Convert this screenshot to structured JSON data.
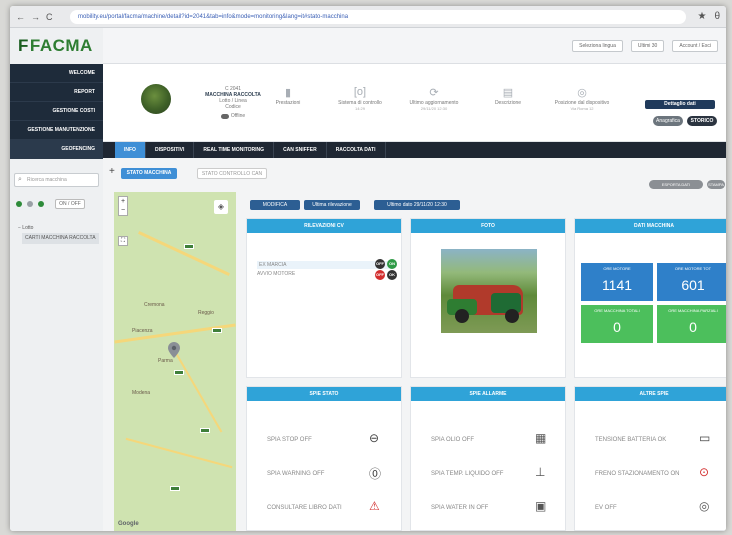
{
  "browser": {
    "nav": [
      "←",
      "→",
      "C"
    ],
    "url": "mobility.eu/portal/facma/machine/detail?id=2041&tab=info&mode=monitoring&lang=it#stato-macchina",
    "ext": [
      "★",
      "θ"
    ]
  },
  "sidebar": {
    "logo_prefix": "F",
    "logo_text": "FACMA",
    "items": [
      {
        "label": "WELCOME"
      },
      {
        "label": "REPORT"
      },
      {
        "label": "GESTIONE COSTI"
      },
      {
        "label": "GESTIONE MANUTENZIONE"
      },
      {
        "label": "GEOFENCING"
      }
    ],
    "search_placeholder": "Ricerca macchina",
    "filter_toggle": "ON / OFF",
    "tree_root": "− Lotto",
    "tree_leaf": "CARTI MACCHINA RACCOLTA"
  },
  "topbar": {
    "sel1": "Seleziona lingua",
    "sel2": "Ultimi 30",
    "user": "Account / Esci"
  },
  "machine": {
    "code": "C 2041",
    "name": "MACCHINA RACCOLTA",
    "line2": "Lotto / Linea",
    "line3": "Codice",
    "status": "Offline",
    "stats": [
      {
        "icon": "bar-chart-icon",
        "glyph": "▮",
        "label": "Prestazioni",
        "sub": ""
      },
      {
        "icon": "log-icon",
        "glyph": "[o]",
        "label": "Sistema di controllo",
        "sub": "14:29"
      },
      {
        "icon": "refresh-icon",
        "glyph": "⟳",
        "label": "Ultimo aggiornamento",
        "sub": "29/11/20 12:30"
      },
      {
        "icon": "document-icon",
        "glyph": "▤",
        "label": "Descrizione",
        "sub": ""
      },
      {
        "icon": "location-icon",
        "glyph": "◎",
        "label": "Posizione dal dispositivo",
        "sub": "Via Roma 12"
      }
    ],
    "btn_top": "Dettaglio dati",
    "btn_gray": "Anagrafica",
    "btn_dark": "STORICO"
  },
  "tabs": [
    "INFO",
    "DISPOSITIVI",
    "REAL TIME MONITORING",
    "CAN SNIFFER",
    "RACCOLTA DATI"
  ],
  "subtabs": {
    "plus": "+",
    "active": "STATO MACCHINA",
    "inactive": "STATO CONTROLLO CAN",
    "pill1": "ESPORTA DATI",
    "pill2": "STAMPA"
  },
  "map": {
    "zoom_in": "+",
    "zoom_out": "−",
    "fullscreen": "⛶",
    "layers": "◈",
    "google": "Google",
    "towns": [
      "Piacenza",
      "Parma",
      "Reggio",
      "Modena",
      "Cremona"
    ]
  },
  "infostrip": {
    "modifica": "MODIFICA",
    "mid": "Ultima rilevazione",
    "last": "Ultimo dato 29/11/20 12:30"
  },
  "panels": {
    "rilevazioni": {
      "title": "RILEVAZIONI CV",
      "rows": [
        {
          "label": "EX MARCIA",
          "badge1": "OFF",
          "badge1_color": "#333333",
          "badge2": "ON",
          "badge2_color": "#2e9a45"
        },
        {
          "label": "AVVIO MOTORE",
          "badge1": "OFF",
          "badge1_color": "#d32f2f",
          "badge2": "OK",
          "badge2_color": "#333333"
        }
      ]
    },
    "foto": {
      "title": "FOTO"
    },
    "dati": {
      "title": "DATI MACCHINA",
      "tiles": [
        {
          "label": "ORE MOTORE",
          "value": "1141",
          "color": "#2f80c9"
        },
        {
          "label": "ORE MOTORE TOT",
          "value": "601",
          "color": "#2f80c9"
        },
        {
          "label": "ORE MACCHINA TOTALI",
          "value": "0",
          "color": "#4cbf5c"
        },
        {
          "label": "ORE MACCHINA PARZIALI",
          "value": "0",
          "color": "#4cbf5c"
        }
      ]
    },
    "spie_stato": {
      "title": "SPIE STATO",
      "items": [
        {
          "label": "SPIA STOP OFF",
          "icon": "stop-indicator-icon",
          "glyph": "⊖",
          "color": "#444444"
        },
        {
          "label": "SPIA WARNING OFF",
          "icon": "warning-indicator-icon",
          "glyph": "⓪",
          "color": "#444444"
        },
        {
          "label": "CONSULTARE LIBRO DATI",
          "icon": "warning-triangle-icon",
          "glyph": "⚠",
          "color": "#d32f2f"
        }
      ]
    },
    "spie_allarme": {
      "title": "SPIE ALLARME",
      "items": [
        {
          "label": "SPIA OLIO OFF",
          "icon": "oil-icon",
          "glyph": "▦",
          "color": "#555555"
        },
        {
          "label": "SPIA TEMP. LIQUIDO OFF",
          "icon": "thermometer-icon",
          "glyph": "⊥",
          "color": "#555555"
        },
        {
          "label": "SPIA WATER IN OFF",
          "icon": "water-filter-icon",
          "glyph": "▣",
          "color": "#555555"
        }
      ]
    },
    "altre_spie": {
      "title": "ALTRE SPIE",
      "items": [
        {
          "label": "TENSIONE BATTERIA OK",
          "icon": "battery-icon",
          "glyph": "▭",
          "color": "#444444"
        },
        {
          "label": "FRENO STAZIONAMENTO ON",
          "icon": "parking-brake-icon",
          "glyph": "⊙",
          "color": "#d32f2f"
        },
        {
          "label": "EV OFF",
          "icon": "ev-icon",
          "glyph": "◎",
          "color": "#555555"
        }
      ]
    }
  }
}
